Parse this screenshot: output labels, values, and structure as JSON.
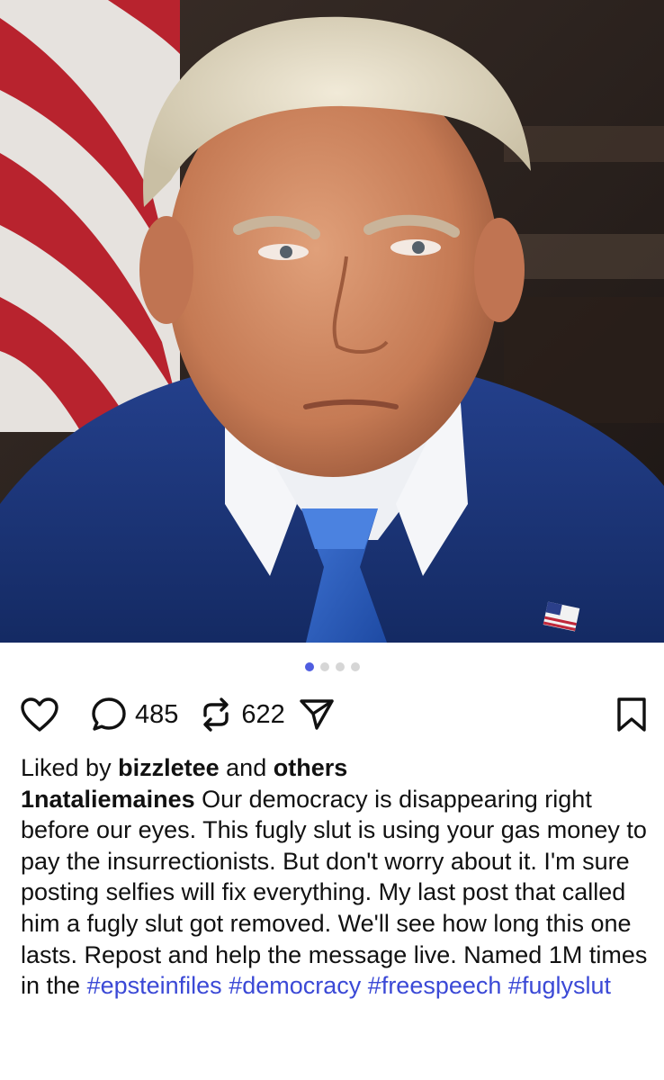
{
  "post": {
    "image_alt": "Portrait photo of a man in a navy suit and blue tie in front of an American flag",
    "carousel": {
      "total": 4,
      "active": 1
    },
    "actions": {
      "like_icon": "heart-icon",
      "comment_icon": "comment-bubble-icon",
      "comment_count": "485",
      "repost_icon": "repost-icon",
      "repost_count": "622",
      "share_icon": "send-icon",
      "save_icon": "bookmark-icon"
    },
    "likes": {
      "prefix": "Liked by",
      "user": "bizzletee",
      "conjunction": "and",
      "others": "others"
    },
    "caption": {
      "username": "1nataliemaines",
      "text": "Our democracy is disappearing right before our eyes. This fugly slut is using your gas money to pay the insurrectionists. But don't worry about it. I'm sure posting selfies will fix everything. My last post that called him a fugly slut got removed.  We'll see how long this one lasts. Repost and help the message live. Named 1M times in the",
      "hashtags": [
        "#epsteinfiles",
        "#democracy",
        "#freespeech",
        "#fuglyslut"
      ]
    },
    "colors": {
      "hashtag": "#3b49d6",
      "carousel_active": "#4f5de0",
      "carousel_inactive": "#d6d6d6"
    }
  }
}
